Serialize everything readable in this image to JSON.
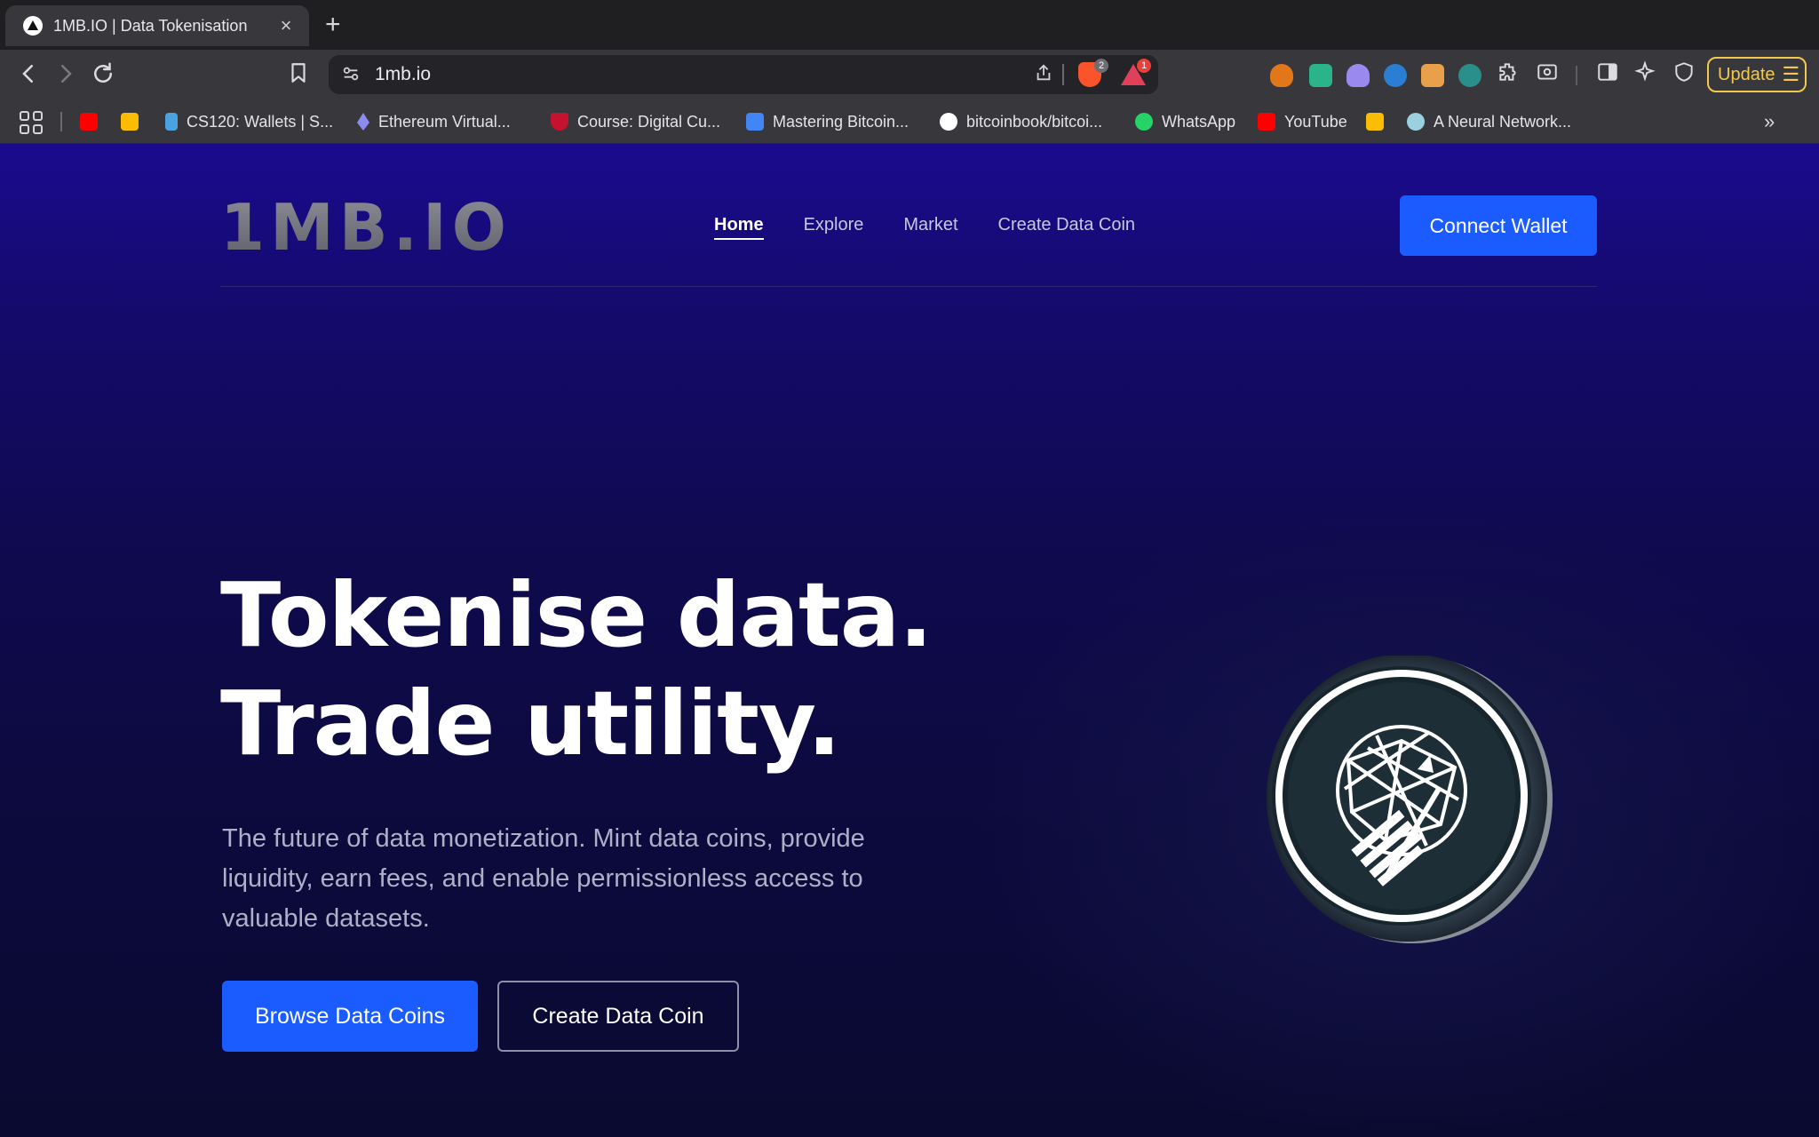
{
  "browser": {
    "tab_title": "1MB.IO | Data Tokenisation",
    "close_glyph": "×",
    "new_tab_glyph": "+",
    "url": "1mb.io",
    "brave_shield_count": "2",
    "rewards_count": "1",
    "update_label": "Update",
    "bookmarks": [
      {
        "label": "",
        "icon": "youtube-icon",
        "color": "#ff0000"
      },
      {
        "label": "",
        "icon": "keep-icon",
        "color": "#fbbc04"
      },
      {
        "label": "CS120: Wallets | S...",
        "icon": "lightning-icon",
        "color": "#4aa3df"
      },
      {
        "label": "Ethereum Virtual...",
        "icon": "ethereum-icon",
        "color": "#8c8cf0"
      },
      {
        "label": "Course: Digital Cu...",
        "icon": "shield-crest-icon",
        "color": "#c41230"
      },
      {
        "label": "Mastering Bitcoin...",
        "icon": "docs-icon",
        "color": "#4285f4"
      },
      {
        "label": "bitcoinbook/bitcoi...",
        "icon": "github-icon",
        "color": "#ffffff"
      },
      {
        "label": "WhatsApp",
        "icon": "whatsapp-icon",
        "color": "#25d366"
      },
      {
        "label": "YouTube",
        "icon": "youtube-icon",
        "color": "#ff0000"
      },
      {
        "label": "",
        "icon": "keep-icon",
        "color": "#fbbc04"
      },
      {
        "label": "A Neural Network...",
        "icon": "neural-icon",
        "color": "#9ad0e0"
      }
    ]
  },
  "site": {
    "logo": "1MB.IO",
    "nav": [
      "Home",
      "Explore",
      "Market",
      "Create Data Coin"
    ],
    "connect_wallet": "Connect Wallet",
    "hero_line1": "Tokenise data.",
    "hero_line2": "Trade utility.",
    "subtitle": "The future of data monetization. Mint data coins, provide liquidity, earn fees, and enable permissionless access to valuable datasets.",
    "primary_cta": "Browse Data Coins",
    "secondary_cta": "Create Data Coin"
  },
  "colors": {
    "accent": "#1a5cff",
    "update": "#f2c94c"
  }
}
